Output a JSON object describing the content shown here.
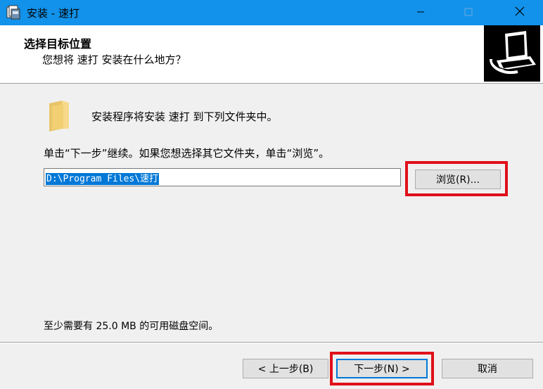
{
  "window": {
    "title": "安装 - 速打",
    "controls": {
      "minimize": "—",
      "maximize": "☐",
      "close": "✕"
    }
  },
  "header": {
    "title": "选择目标位置",
    "subtitle": "您想将 速打 安装在什么地方？"
  },
  "body": {
    "install_line": "安装程序将安装 速打 到下列文件夹中。",
    "instruction": "单击“下一步”继续。如果您想选择其它文件夹，单击“浏览”。",
    "path_value": "D:\\Program Files\\速打",
    "browse_label": "浏览(R)...",
    "disk_space": "至少需要有 25.0 MB 的可用磁盘空间。"
  },
  "footer": {
    "back_label": "< 上一步(B)",
    "next_label": "下一步(N) >",
    "cancel_label": "取消"
  },
  "colors": {
    "titlebar": "#1292ea",
    "highlight": "#e0101a",
    "focus_border": "#0078d7"
  },
  "icons": [
    "installer-icon",
    "minimize-icon",
    "maximize-icon",
    "close-icon",
    "wizard-image-icon",
    "folder-icon"
  ]
}
